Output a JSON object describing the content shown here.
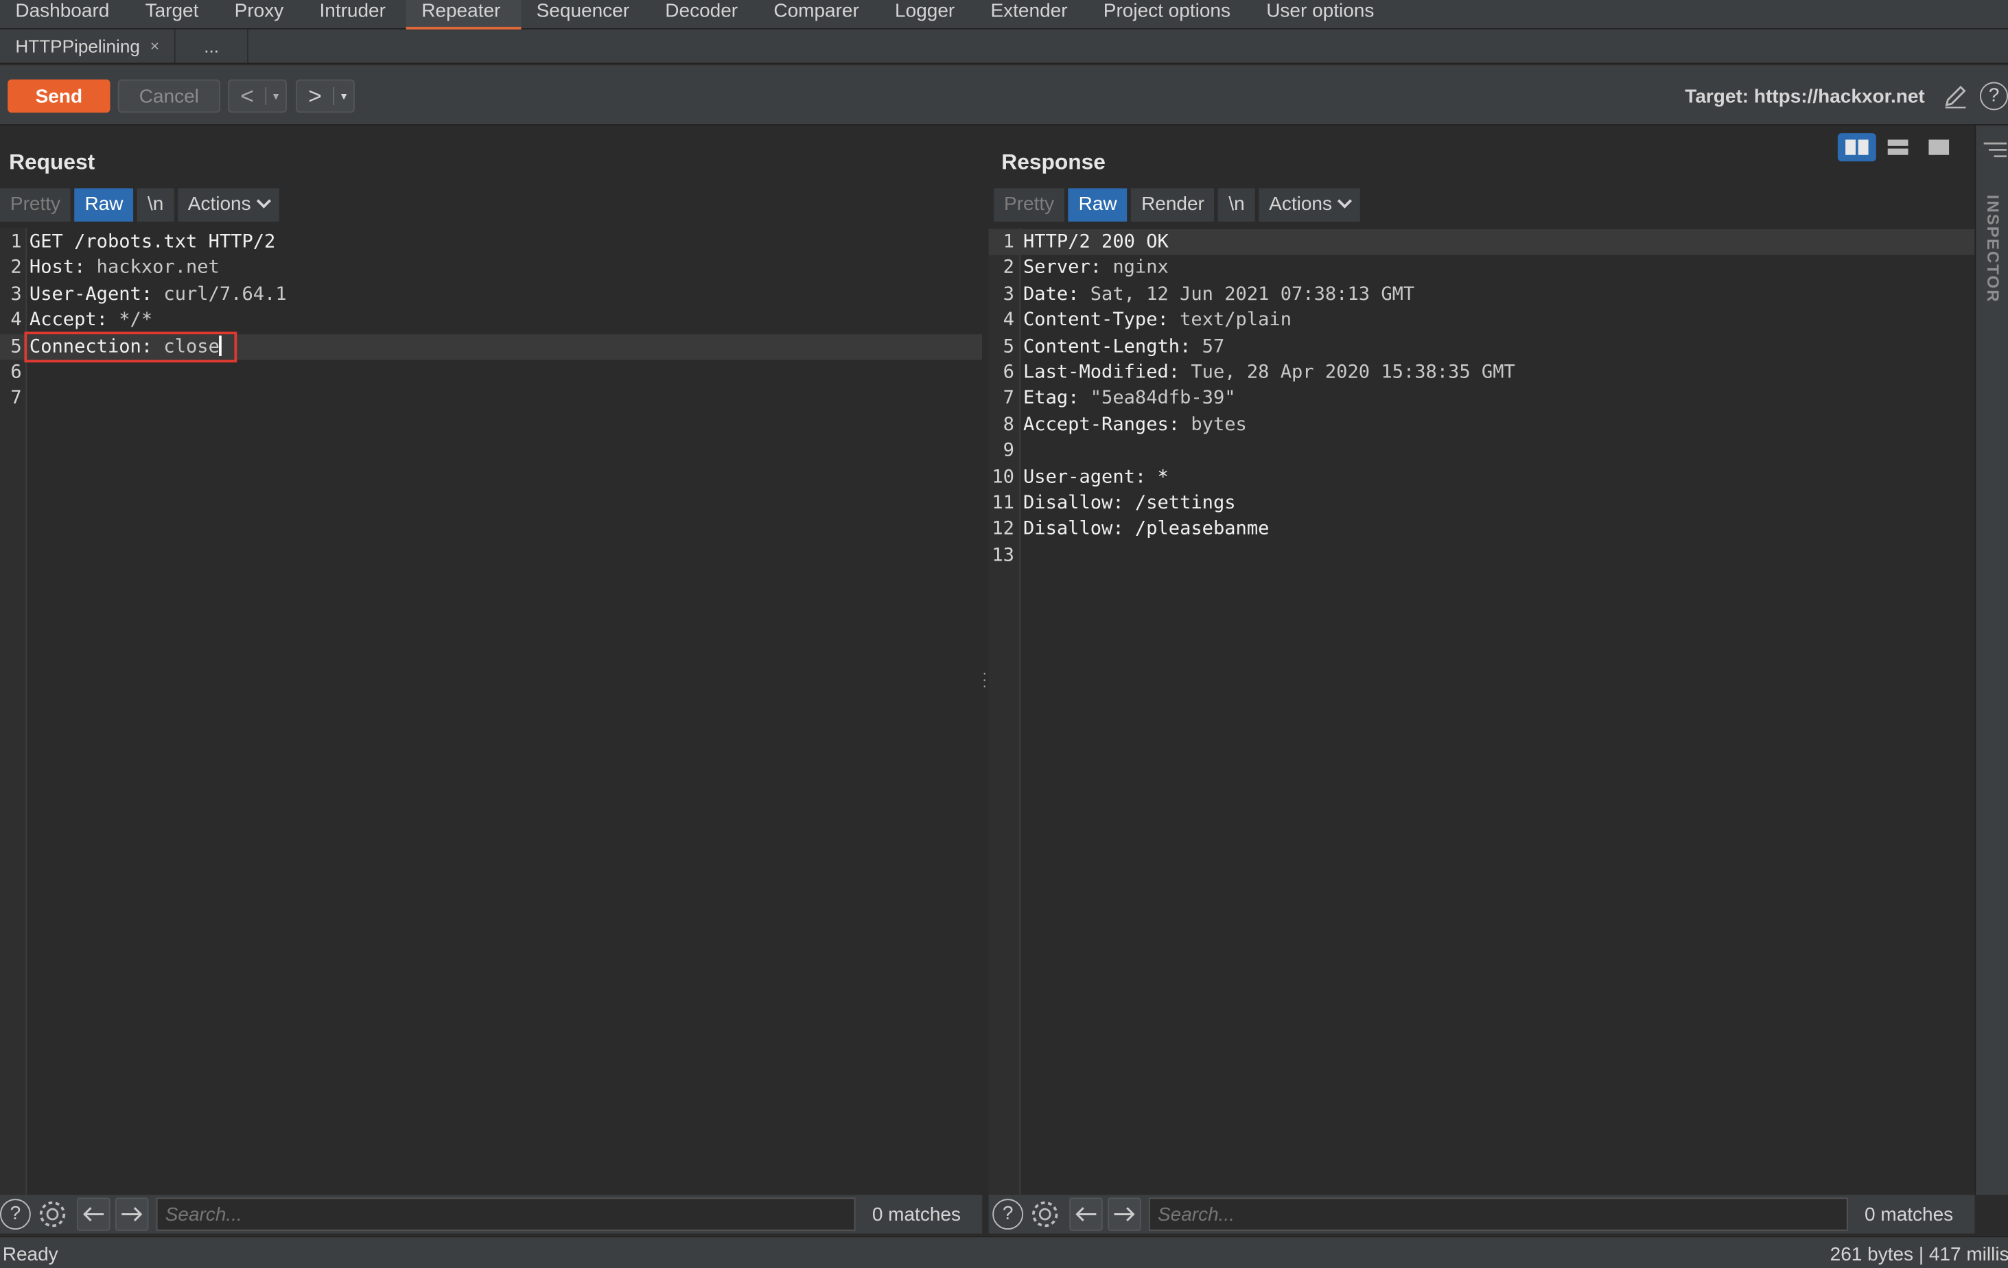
{
  "main_tabs": [
    "Dashboard",
    "Target",
    "Proxy",
    "Intruder",
    "Repeater",
    "Sequencer",
    "Decoder",
    "Comparer",
    "Logger",
    "Extender",
    "Project options",
    "User options"
  ],
  "main_tab_active": "Repeater",
  "sub_tabs": {
    "tab_label": "HTTPPipelining",
    "close_glyph": "×",
    "more_label": "..."
  },
  "toolbar": {
    "send_label": "Send",
    "cancel_label": "Cancel",
    "back_glyph": "<",
    "forward_glyph": ">",
    "dropdown_glyph": "▾",
    "target_label": "Target: https://hackxor.net",
    "help_glyph": "?"
  },
  "request": {
    "title": "Request",
    "modes": {
      "pretty": "Pretty",
      "raw": "Raw",
      "newline": "\\n",
      "actions": "Actions"
    },
    "lines": [
      {
        "num": "1",
        "key": "GET /robots.txt HTTP/2",
        "value": ""
      },
      {
        "num": "2",
        "key": "Host:",
        "value": " hackxor.net"
      },
      {
        "num": "3",
        "key": "User-Agent:",
        "value": " curl/7.64.1"
      },
      {
        "num": "4",
        "key": "Accept:",
        "value": " */*"
      },
      {
        "num": "5",
        "key": "Connection:",
        "value": " close"
      },
      {
        "num": "6",
        "key": "",
        "value": ""
      },
      {
        "num": "7",
        "key": "",
        "value": ""
      }
    ],
    "search_placeholder": "Search...",
    "matches": "0 matches"
  },
  "response": {
    "title": "Response",
    "modes": {
      "pretty": "Pretty",
      "raw": "Raw",
      "render": "Render",
      "newline": "\\n",
      "actions": "Actions"
    },
    "lines": [
      {
        "num": "1",
        "key": "HTTP/2 200 OK",
        "value": ""
      },
      {
        "num": "2",
        "key": "Server:",
        "value": " nginx"
      },
      {
        "num": "3",
        "key": "Date:",
        "value": " Sat, 12 Jun 2021 07:38:13 GMT"
      },
      {
        "num": "4",
        "key": "Content-Type:",
        "value": " text/plain"
      },
      {
        "num": "5",
        "key": "Content-Length:",
        "value": " 57"
      },
      {
        "num": "6",
        "key": "Last-Modified:",
        "value": " Tue, 28 Apr 2020 15:38:35 GMT"
      },
      {
        "num": "7",
        "key": "Etag:",
        "value": " \"5ea84dfb-39\""
      },
      {
        "num": "8",
        "key": "Accept-Ranges:",
        "value": " bytes"
      },
      {
        "num": "9",
        "key": "",
        "value": ""
      },
      {
        "num": "10",
        "key": "User-agent: *",
        "value": ""
      },
      {
        "num": "11",
        "key": "Disallow: /settings",
        "value": ""
      },
      {
        "num": "12",
        "key": "Disallow: /pleasebanme",
        "value": ""
      },
      {
        "num": "13",
        "key": "",
        "value": ""
      }
    ],
    "search_placeholder": "Search...",
    "matches": "0 matches"
  },
  "inspector": {
    "label": "INSPECTOR"
  },
  "status": {
    "left": "Ready",
    "right": "261 bytes | 417 millis"
  },
  "colors": {
    "accent": "#e8612c",
    "selected": "#2d6bb0",
    "highlight_box": "#e03a30",
    "background": "#2b2b2b",
    "panel": "#3c3f41"
  }
}
